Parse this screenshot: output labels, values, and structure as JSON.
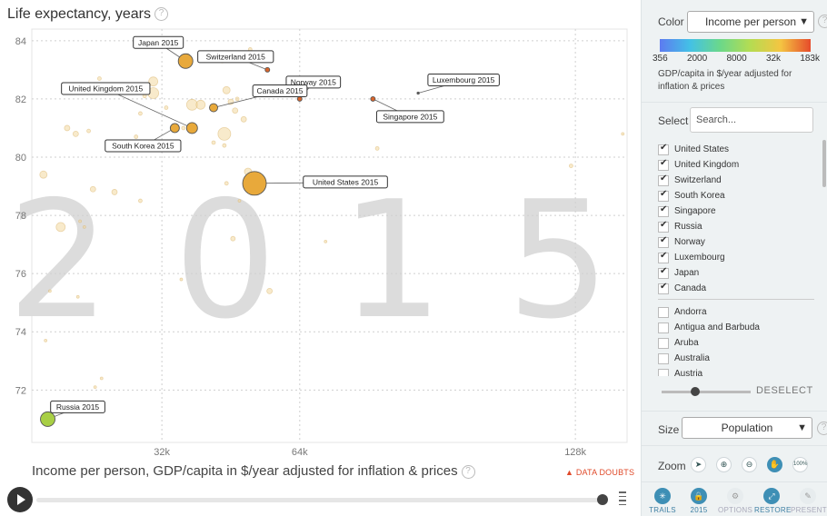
{
  "chart_title": "Life expectancy, years",
  "x_title": "Income per person, GDP/capita in $/year adjusted for inflation & prices",
  "help": "?",
  "year_watermark": "2015",
  "data_doubts": "DATA DOUBTS",
  "chart_data": {
    "type": "scatter",
    "title": "Life expectancy, years",
    "xlabel": "Income per person, GDP/capita in $/year adjusted for inflation & prices",
    "ylabel": "Life expectancy, years",
    "x_scale": "linear",
    "xlim": [
      1800,
      140000
    ],
    "ylim": [
      70.2,
      84.4
    ],
    "x_ticks": [
      32000,
      64000,
      128000
    ],
    "x_tick_labels": [
      "32k",
      "64k",
      "128k"
    ],
    "y_ticks": [
      72,
      74,
      76,
      78,
      80,
      82,
      84
    ],
    "grid": true,
    "labeled_points": [
      {
        "label": "Japan 2015",
        "x": 37500,
        "y": 83.3,
        "r": 8,
        "color": "#e8a93b"
      },
      {
        "label": "Switzerland 2015",
        "x": 56500,
        "y": 83.0,
        "r": 2.5,
        "color": "#d9652b"
      },
      {
        "label": "Norway 2015",
        "x": 64000,
        "y": 82.0,
        "r": 2.5,
        "color": "#d9652b"
      },
      {
        "label": "Luxembourg 2015",
        "x": 91500,
        "y": 82.2,
        "r": 1.2,
        "color": "#666666"
      },
      {
        "label": "United Kingdom 2015",
        "x": 39000,
        "y": 81.0,
        "r": 6,
        "color": "#e8a93b"
      },
      {
        "label": "Canada 2015",
        "x": 44000,
        "y": 81.7,
        "r": 4.5,
        "color": "#e8a93b"
      },
      {
        "label": "Singapore 2015",
        "x": 81000,
        "y": 82.0,
        "r": 2.5,
        "color": "#d9652b"
      },
      {
        "label": "South Korea 2015",
        "x": 35000,
        "y": 81.0,
        "r": 5,
        "color": "#e8a93b"
      },
      {
        "label": "United States 2015",
        "x": 53500,
        "y": 79.1,
        "r": 13,
        "color": "#e8a93b"
      },
      {
        "label": "Russia 2015",
        "x": 5500,
        "y": 71.0,
        "r": 8,
        "color": "#a8cf45"
      }
    ],
    "background_points": [
      {
        "x": 4500,
        "y": 79.4,
        "r": 4
      },
      {
        "x": 10000,
        "y": 81.0,
        "r": 3
      },
      {
        "x": 12000,
        "y": 80.8,
        "r": 3
      },
      {
        "x": 15000,
        "y": 80.9,
        "r": 2
      },
      {
        "x": 30000,
        "y": 82.6,
        "r": 5
      },
      {
        "x": 30000,
        "y": 82.2,
        "r": 6
      },
      {
        "x": 28000,
        "y": 82.1,
        "r": 2
      },
      {
        "x": 27000,
        "y": 81.5,
        "r": 2
      },
      {
        "x": 33000,
        "y": 81.7,
        "r": 2
      },
      {
        "x": 26000,
        "y": 80.7,
        "r": 2
      },
      {
        "x": 39000,
        "y": 81.8,
        "r": 6
      },
      {
        "x": 41000,
        "y": 81.8,
        "r": 5
      },
      {
        "x": 47000,
        "y": 82.3,
        "r": 4
      },
      {
        "x": 48000,
        "y": 81.9,
        "r": 3
      },
      {
        "x": 49000,
        "y": 81.6,
        "r": 3
      },
      {
        "x": 46500,
        "y": 80.8,
        "r": 7
      },
      {
        "x": 46500,
        "y": 80.4,
        "r": 2
      },
      {
        "x": 44000,
        "y": 80.5,
        "r": 2
      },
      {
        "x": 51000,
        "y": 81.3,
        "r": 3
      },
      {
        "x": 49500,
        "y": 82.0,
        "r": 2
      },
      {
        "x": 52500,
        "y": 83.7,
        "r": 2
      },
      {
        "x": 38000,
        "y": 83.5,
        "r": 2
      },
      {
        "x": 46000,
        "y": 83.3,
        "r": 2
      },
      {
        "x": 37000,
        "y": 81.0,
        "r": 2
      },
      {
        "x": 8500,
        "y": 77.6,
        "r": 5
      },
      {
        "x": 13000,
        "y": 77.8,
        "r": 1.5
      },
      {
        "x": 14000,
        "y": 77.6,
        "r": 1.5
      },
      {
        "x": 16000,
        "y": 78.9,
        "r": 3
      },
      {
        "x": 21000,
        "y": 78.8,
        "r": 3
      },
      {
        "x": 27000,
        "y": 78.5,
        "r": 2
      },
      {
        "x": 52000,
        "y": 79.5,
        "r": 4
      },
      {
        "x": 47000,
        "y": 79.1,
        "r": 2
      },
      {
        "x": 50000,
        "y": 78.5,
        "r": 1.5
      },
      {
        "x": 57000,
        "y": 75.4,
        "r": 3
      },
      {
        "x": 48500,
        "y": 77.2,
        "r": 2.5
      },
      {
        "x": 70000,
        "y": 77.1,
        "r": 1.5
      },
      {
        "x": 82000,
        "y": 80.3,
        "r": 2
      },
      {
        "x": 127000,
        "y": 79.7,
        "r": 2
      },
      {
        "x": 139000,
        "y": 80.8,
        "r": 1.5
      },
      {
        "x": 6000,
        "y": 75.4,
        "r": 1.5
      },
      {
        "x": 12500,
        "y": 75.2,
        "r": 1.5
      },
      {
        "x": 5000,
        "y": 73.7,
        "r": 1.5
      },
      {
        "x": 18000,
        "y": 72.4,
        "r": 1.5
      },
      {
        "x": 36500,
        "y": 75.8,
        "r": 1.5
      },
      {
        "x": 16500,
        "y": 72.1,
        "r": 1.5
      },
      {
        "x": 17500,
        "y": 82.7,
        "r": 2
      },
      {
        "x": 42000,
        "y": 83.3,
        "r": 1.5
      }
    ]
  },
  "sidebar": {
    "color_label": "Color",
    "color_value": "Income per person",
    "color_scale_ticks": [
      "356",
      "2000",
      "8000",
      "32k",
      "183k"
    ],
    "color_scale_desc": "GDP/capita in $/year adjusted for inflation & prices",
    "select_label": "Select",
    "search_placeholder": "Search...",
    "selected_countries": [
      "United States",
      "United Kingdom",
      "Switzerland",
      "South Korea",
      "Singapore",
      "Russia",
      "Norway",
      "Luxembourg",
      "Japan",
      "Canada"
    ],
    "other_countries": [
      "Andorra",
      "Antigua and Barbuda",
      "Aruba",
      "Australia",
      "Austria"
    ],
    "deselect_label": "DESELECT",
    "size_label": "Size",
    "size_value": "Population",
    "zoom_label": "Zoom",
    "zoom_percent": "100%",
    "bottom_buttons": [
      {
        "label": "TRAILS",
        "icon": "trails-icon",
        "glyph": "✳",
        "active": true
      },
      {
        "label": "2015",
        "icon": "lock-icon",
        "glyph": "🔒",
        "active": true
      },
      {
        "label": "OPTIONS",
        "icon": "gear-icon",
        "glyph": "⚙",
        "active": false
      },
      {
        "label": "RESTORE",
        "icon": "restore-icon",
        "glyph": "⤢",
        "active": true
      },
      {
        "label": "PRESENT",
        "icon": "present-icon",
        "glyph": "✎",
        "active": false
      }
    ]
  },
  "colors": {
    "accent": "#3e8fb5",
    "label_border": "#333333",
    "warning": "#e04a2a"
  }
}
